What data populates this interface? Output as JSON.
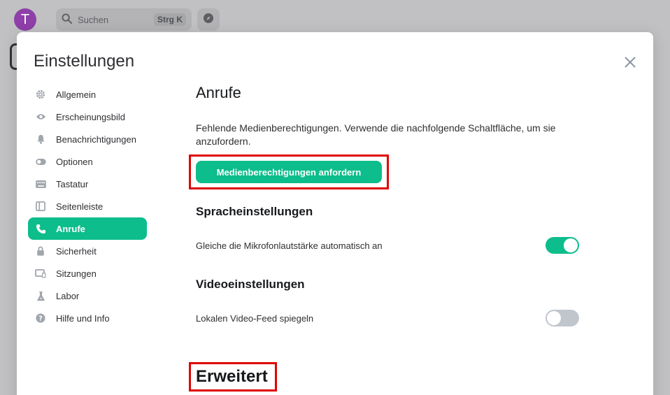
{
  "background": {
    "avatar_letter": "T",
    "search_placeholder": "Suchen",
    "search_shortcut": "Strg K"
  },
  "dialog": {
    "title": "Einstellungen"
  },
  "nav": {
    "items": [
      {
        "label": "Allgemein",
        "icon": "gear-icon"
      },
      {
        "label": "Erscheinungsbild",
        "icon": "eye-icon"
      },
      {
        "label": "Benachrichtigungen",
        "icon": "bell-icon"
      },
      {
        "label": "Optionen",
        "icon": "toggle-icon"
      },
      {
        "label": "Tastatur",
        "icon": "keyboard-icon"
      },
      {
        "label": "Seitenleiste",
        "icon": "sidebar-icon"
      },
      {
        "label": "Anrufe",
        "icon": "phone-icon",
        "active": true
      },
      {
        "label": "Sicherheit",
        "icon": "lock-icon"
      },
      {
        "label": "Sitzungen",
        "icon": "devices-icon"
      },
      {
        "label": "Labor",
        "icon": "flask-icon"
      },
      {
        "label": "Hilfe und Info",
        "icon": "help-icon"
      }
    ]
  },
  "content": {
    "heading": "Anrufe",
    "permission_note": "Fehlende Medienberechtigungen. Verwende die nachfolgende Schaltfläche, um sie anzufordern.",
    "request_button": "Medienberechtigungen anfordern",
    "voice": {
      "heading": "Spracheinstellungen",
      "auto_gain_label": "Gleiche die Mikrofonlautstärke automatisch an",
      "auto_gain_on": true
    },
    "video": {
      "heading": "Videoeinstellungen",
      "mirror_label": "Lokalen Video-Feed spiegeln",
      "mirror_on": false
    },
    "advanced_heading": "Erweitert"
  },
  "colors": {
    "accent": "#0dbd8b",
    "highlight_border": "#e00000",
    "avatar": "#8e3fa8"
  }
}
